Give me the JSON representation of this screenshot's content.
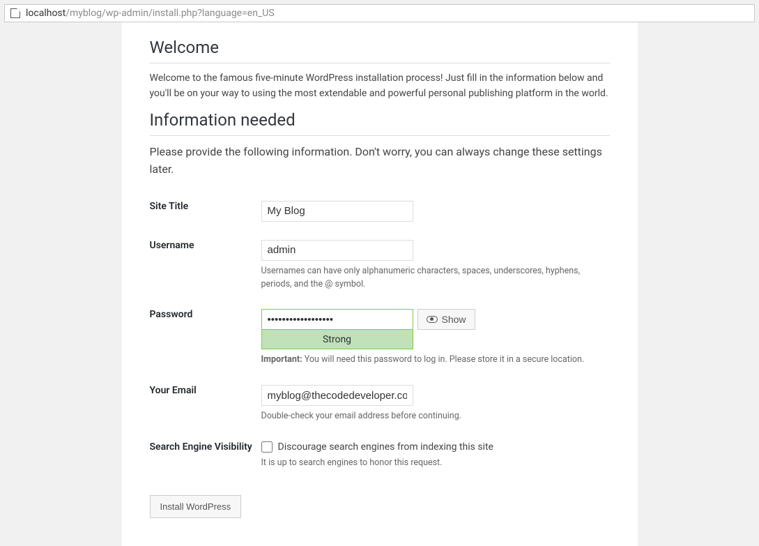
{
  "addrbar": {
    "dark": "localhost",
    "rest": "/myblog/wp-admin/install.php?language=en_US"
  },
  "welcome": {
    "heading": "Welcome",
    "text": "Welcome to the famous five-minute WordPress installation process! Just fill in the information below and you'll be on your way to using the most extendable and powerful personal publishing platform in the world."
  },
  "info": {
    "heading": "Information needed",
    "sub": "Please provide the following information. Don't worry, you can always change these settings later."
  },
  "form": {
    "site_title": {
      "label": "Site Title",
      "value": "My Blog"
    },
    "username": {
      "label": "Username",
      "value": "admin",
      "desc": "Usernames can have only alphanumeric characters, spaces, underscores, hyphens, periods, and the @ symbol."
    },
    "password": {
      "label": "Password",
      "value": "••••••••••••••••••",
      "show_label": "Show",
      "strength": "Strong",
      "important_label": "Important:",
      "important_text": " You will need this password to log in. Please store it in a secure location."
    },
    "email": {
      "label": "Your Email",
      "value": "myblog@thecodedeveloper.com",
      "desc": "Double-check your email address before continuing."
    },
    "sev": {
      "label": "Search Engine Visibility",
      "checkbox_label": "Discourage search engines from indexing this site",
      "desc": "It is up to search engines to honor this request."
    }
  },
  "submit": {
    "label": "Install WordPress"
  }
}
